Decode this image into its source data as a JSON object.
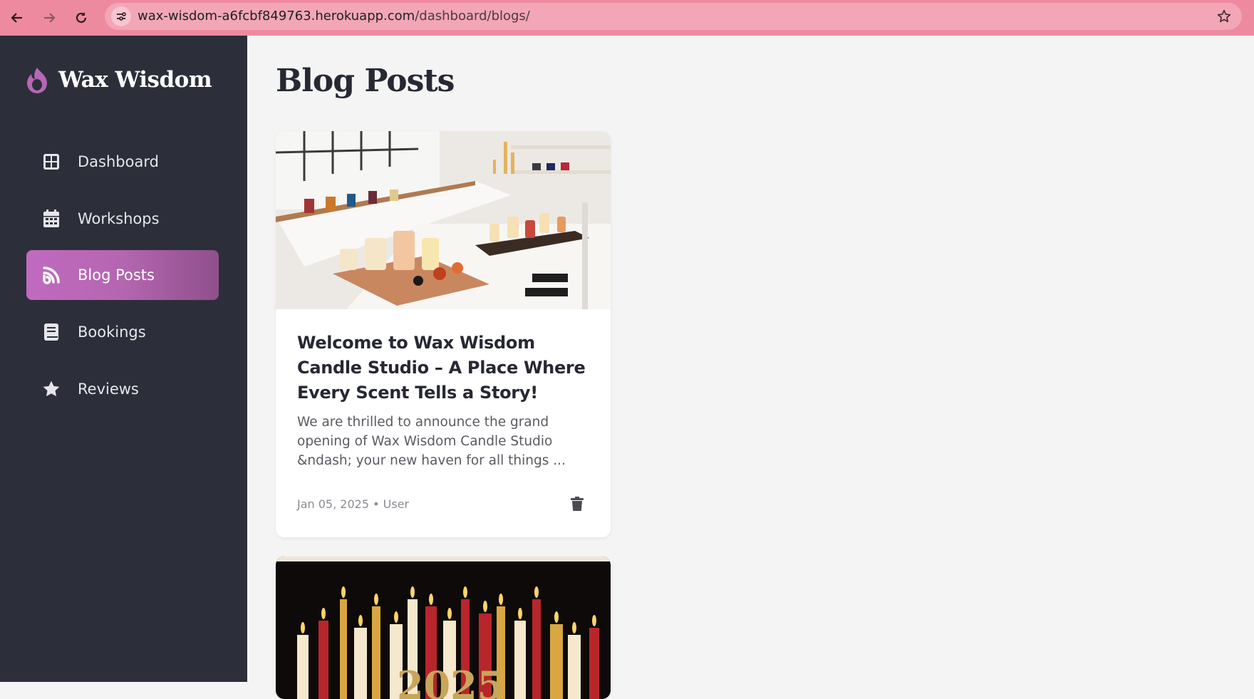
{
  "browser": {
    "url_host": "wax-wisdom-a6fcbf849763.herokuapp.com",
    "url_path": "/dashboard/blogs/"
  },
  "sidebar": {
    "brand": "Wax Wisdom",
    "items": [
      {
        "label": "Dashboard",
        "icon": "dashboard-grid-icon"
      },
      {
        "label": "Workshops",
        "icon": "calendar-icon"
      },
      {
        "label": "Blog Posts",
        "icon": "rss-feed-icon",
        "active": true
      },
      {
        "label": "Bookings",
        "icon": "book-icon"
      },
      {
        "label": "Reviews",
        "icon": "star-icon"
      }
    ]
  },
  "main": {
    "title": "Blog Posts",
    "posts": [
      {
        "title": "Welcome to Wax Wisdom Candle Studio – A Place Where Every Scent Tells a Story!",
        "excerpt": "We are thrilled to announce the grand opening of Wax Wisdom Candle Studio &ndash; your new haven for all things ...",
        "date": "Jan 05, 2025",
        "author": "User",
        "image": "candle studio workshop photo"
      },
      {
        "image": "candles with 2025 numbers photo",
        "image_text": "2025"
      }
    ]
  },
  "colors": {
    "chrome": "#ee8aa0",
    "sidebar": "#2c2f3a",
    "accent": "#c06ac0",
    "background": "#f4f4f4"
  }
}
